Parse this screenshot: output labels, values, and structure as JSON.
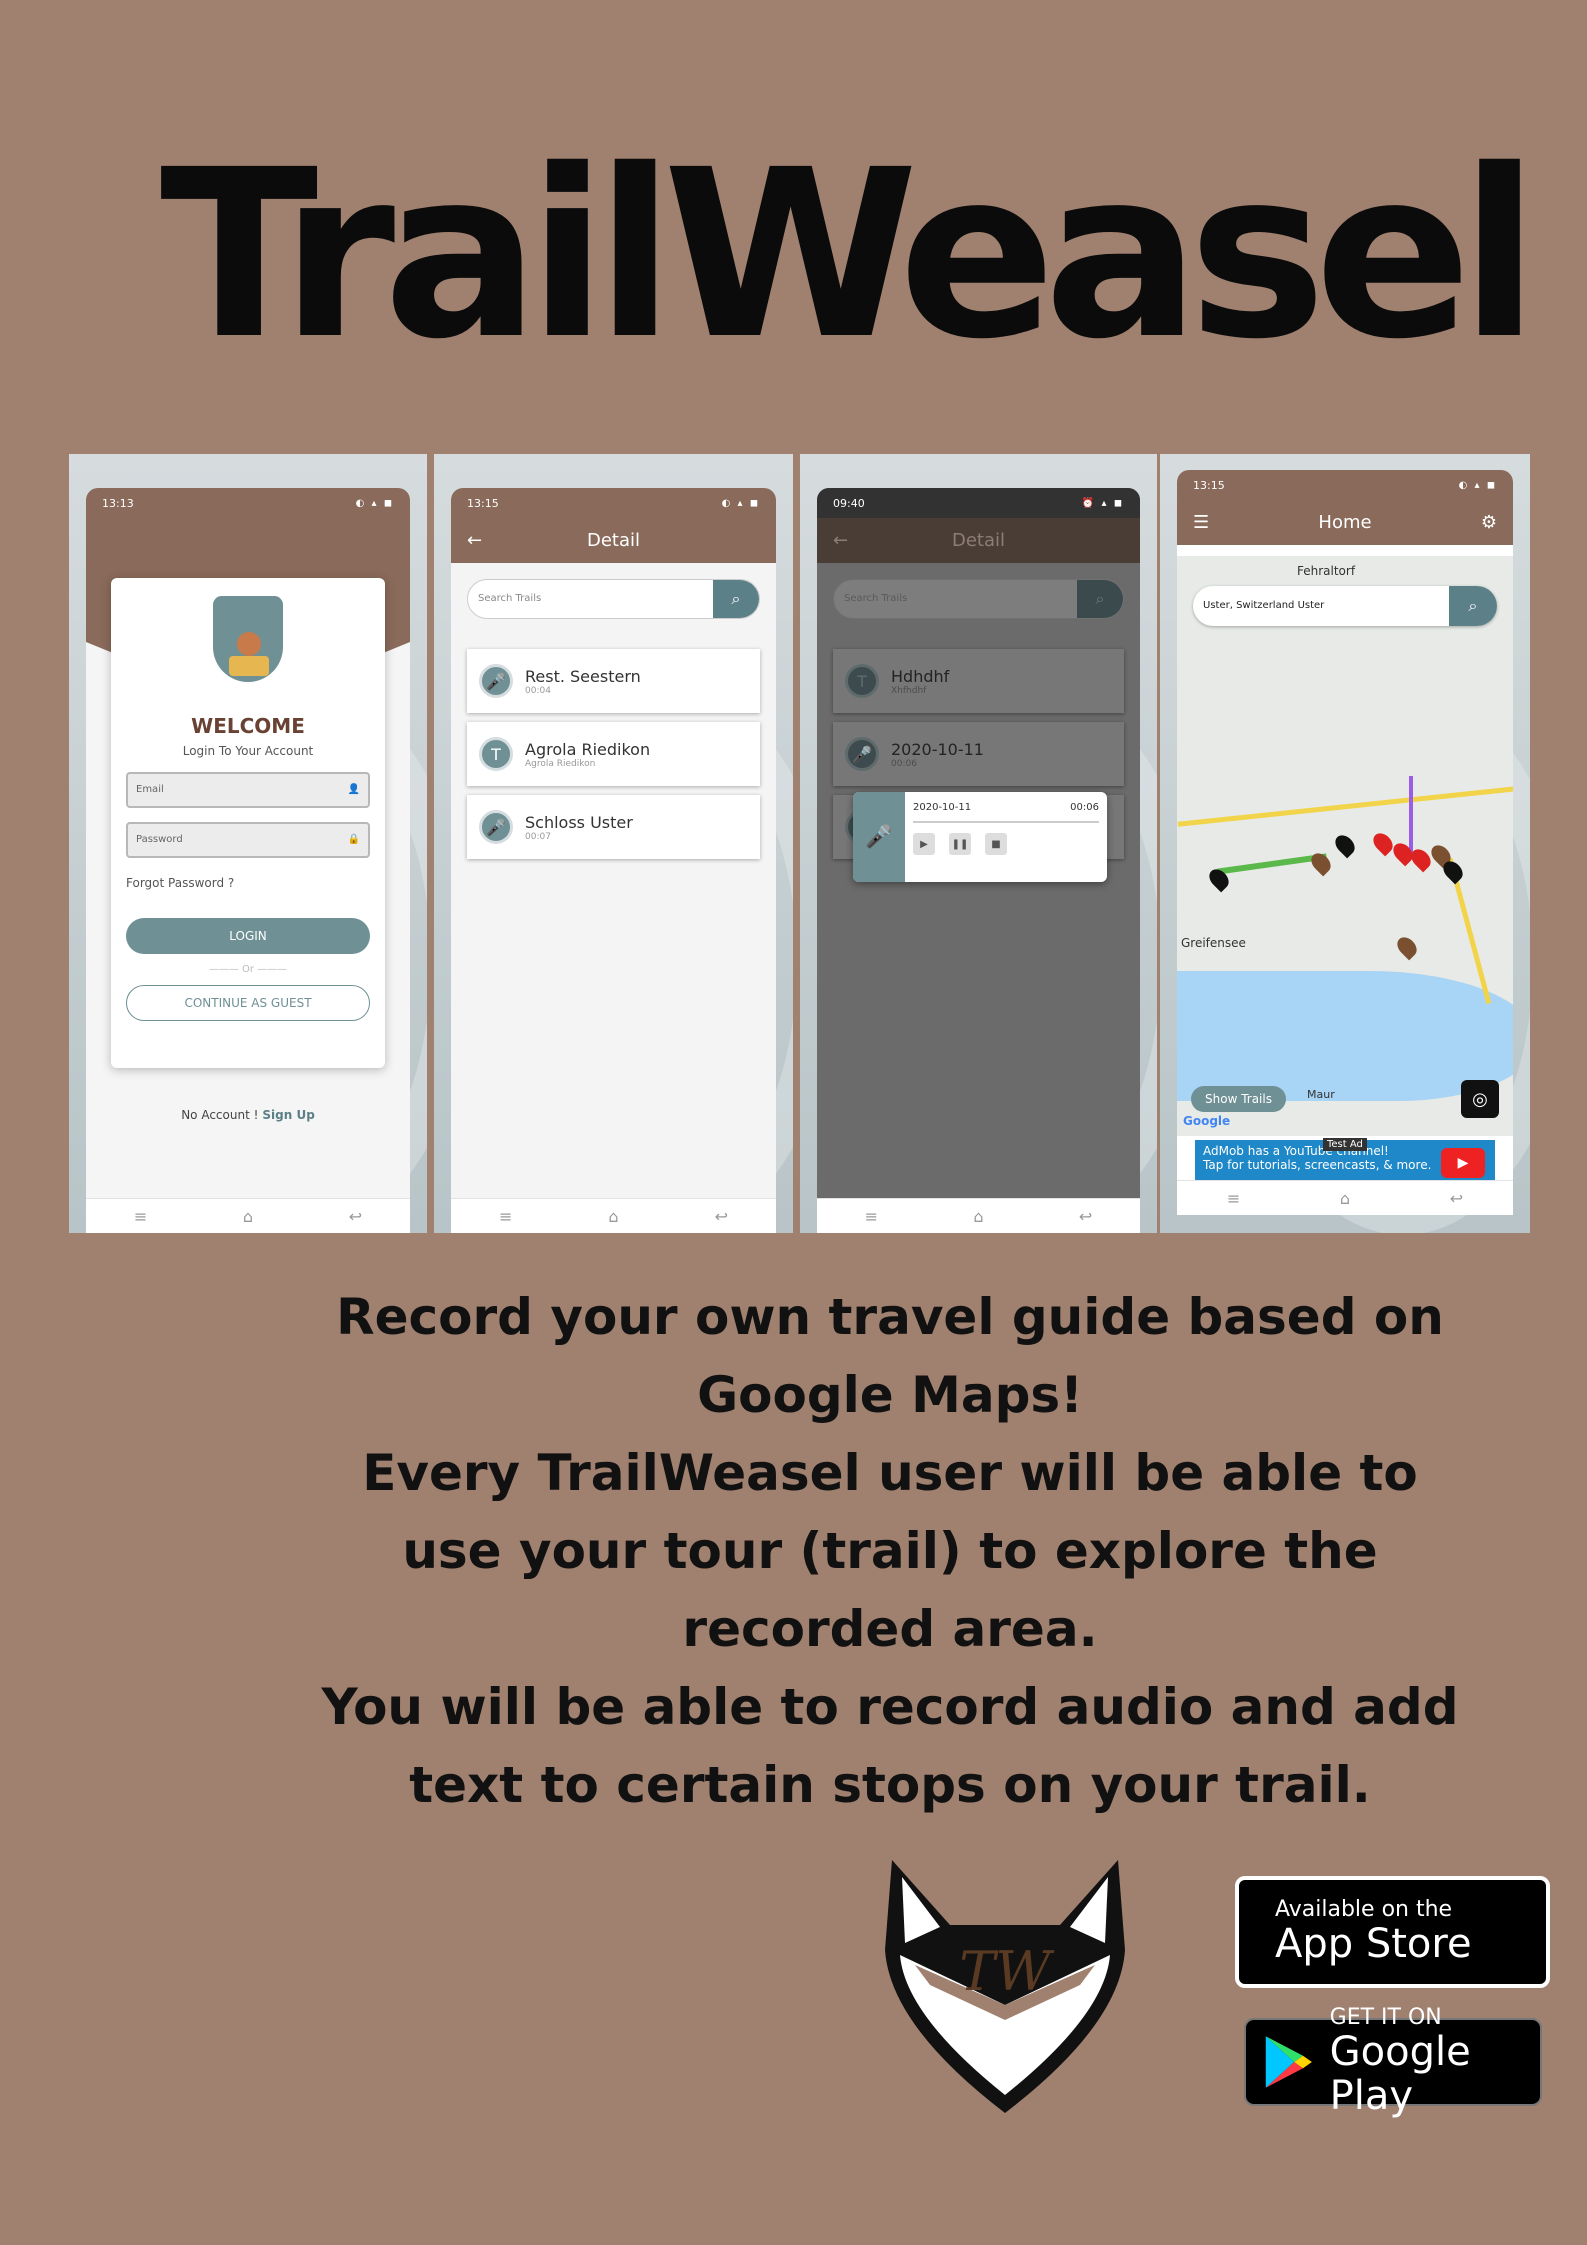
{
  "title": "TrailWeasel",
  "screens": {
    "login": {
      "time": "13:13",
      "welcome": "WELCOME",
      "subtitle": "Login To Your Account",
      "email_placeholder": "Email",
      "password_placeholder": "Password",
      "forgot": "Forgot Password ?",
      "login_label": "LOGIN",
      "or": "Or",
      "guest_label": "CONTINUE AS GUEST",
      "no_account": "No Account !",
      "signup_label": "Sign Up"
    },
    "detail": {
      "time": "13:15",
      "title": "Detail",
      "search_placeholder": "Search Trails",
      "items": [
        {
          "name": "Rest. Seestern",
          "sub": "00:04"
        },
        {
          "name": "Agrola Riedikon",
          "sub": "Agrola Riedikon"
        },
        {
          "name": "Schloss Uster",
          "sub": "00:07"
        }
      ]
    },
    "player": {
      "time": "09:40",
      "title": "Detail",
      "search_placeholder": "Search Trails",
      "items": [
        {
          "name": "Hdhdhf",
          "sub": "Xhfhdhf"
        },
        {
          "name": "2020-10-11",
          "sub": "00:06"
        }
      ],
      "popup_date": "2020-10-11",
      "popup_duration": "00:06"
    },
    "home": {
      "time": "13:15",
      "title": "Home",
      "search_value": "Uster, Switzerland Uster",
      "place_fehraltorf": "Fehraltorf",
      "place_greifensee": "Greifensee",
      "place_maur": "Maur",
      "show_trails": "Show Trails",
      "google": "Google",
      "ad_tag": "Test Ad",
      "ad_line1": "AdMob has a YouTube channel!",
      "ad_line2": "Tap for tutorials, screencasts, & more."
    }
  },
  "tagline": [
    "Record your own travel guide based on",
    "Google Maps!",
    "Every TrailWeasel user will be able to",
    "use your tour (trail) to explore the",
    "recorded area.",
    "You will be able to record audio and add",
    "text to certain stops on your trail."
  ],
  "logo_text": "TW",
  "badges": {
    "appstore_small": "Available on the",
    "appstore_big": "App Store",
    "gplay_small": "GET IT ON",
    "gplay_big": "Google Play"
  },
  "colors": {
    "background": "#a0806f",
    "brand_brown": "#8a6a5a",
    "accent_teal": "#6f9095"
  }
}
